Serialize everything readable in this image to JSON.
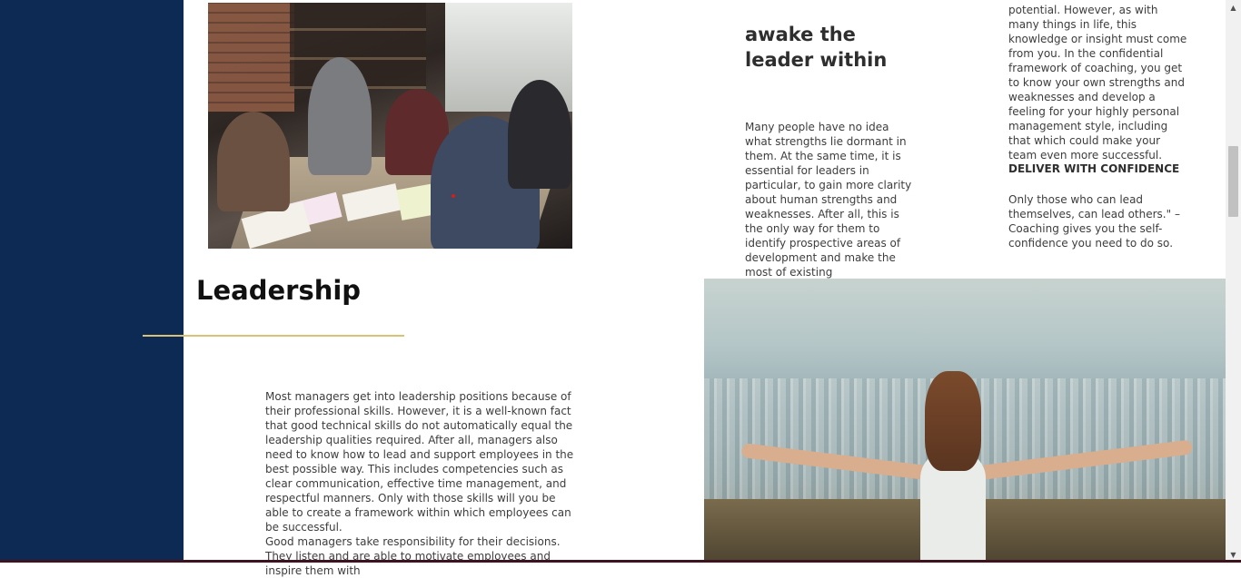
{
  "awake_section": {
    "title": "awake the leader within",
    "strengths_text": "Many people have no idea what strengths lie dormant in them. At the same time, it is essential for leaders in particular, to gain more clarity about human strengths and weaknesses. After all, this is the only way for them to identify prospective areas of development and make the most of existing",
    "potential_text": "potential. However, as with many things in life, this knowledge or insight must come from you. In the confidential framework of coaching, you get to know your own strengths and weaknesses and develop a feeling for your highly personal management style, including that which could make your team even more successful.",
    "deliver_heading": "DELIVER WITH CONFIDENCE",
    "deliver_text": "Only those who can lead themselves, can lead others.\" – Coaching gives you the self-confidence you need to do so."
  },
  "leadership_section": {
    "title": "Leadership",
    "paragraph_1": "Most managers get into leadership positions because of their professional skills. However, it is a well-known fact that good technical skills do not automatically equal the leadership qualities required. After all, managers also need to know how to lead and support employees in the best possible way. This includes competencies such as clear communication, effective time management, and respectful manners. Only with those skills will you be able to create a framework within which employees can be successful.",
    "paragraph_2": "Good managers take responsibility for their decisions. They listen and are able to motivate employees and inspire them with"
  },
  "scrollbar": {
    "up_icon": "▲",
    "down_icon": "▼"
  },
  "colors": {
    "sidebar": "#0d2a55",
    "accent_rule": "#d9c271"
  }
}
